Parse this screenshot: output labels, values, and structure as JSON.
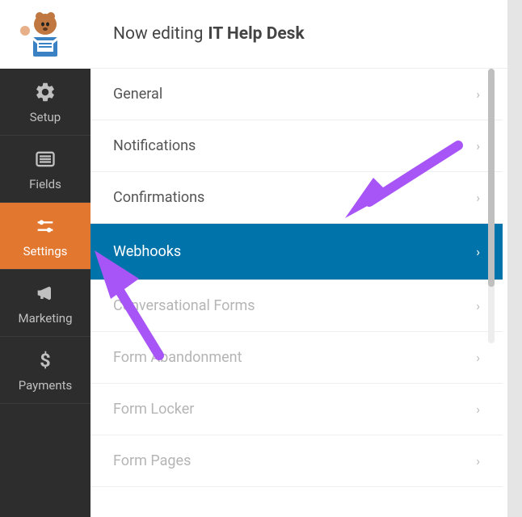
{
  "header": {
    "prefix": "Now editing",
    "title": "IT Help Desk"
  },
  "sidebar": {
    "items": [
      {
        "id": "setup",
        "label": "Setup",
        "icon": "gear-icon"
      },
      {
        "id": "fields",
        "label": "Fields",
        "icon": "list-icon"
      },
      {
        "id": "settings",
        "label": "Settings",
        "icon": "sliders-icon",
        "active": true
      },
      {
        "id": "marketing",
        "label": "Marketing",
        "icon": "bullhorn-icon"
      },
      {
        "id": "payments",
        "label": "Payments",
        "icon": "dollar-icon"
      }
    ]
  },
  "settings_panel": {
    "items": [
      {
        "id": "general",
        "label": "General"
      },
      {
        "id": "notifications",
        "label": "Notifications"
      },
      {
        "id": "confirmations",
        "label": "Confirmations"
      },
      {
        "id": "webhooks",
        "label": "Webhooks",
        "selected": true
      },
      {
        "id": "conversational-forms",
        "label": "Conversational Forms",
        "dim": true
      },
      {
        "id": "form-abandonment",
        "label": "Form Abandonment",
        "dim": true
      },
      {
        "id": "form-locker",
        "label": "Form Locker",
        "dim": true
      },
      {
        "id": "form-pages",
        "label": "Form Pages",
        "dim": true
      }
    ]
  },
  "annotations": {
    "arrow_color": "#a855f7"
  }
}
